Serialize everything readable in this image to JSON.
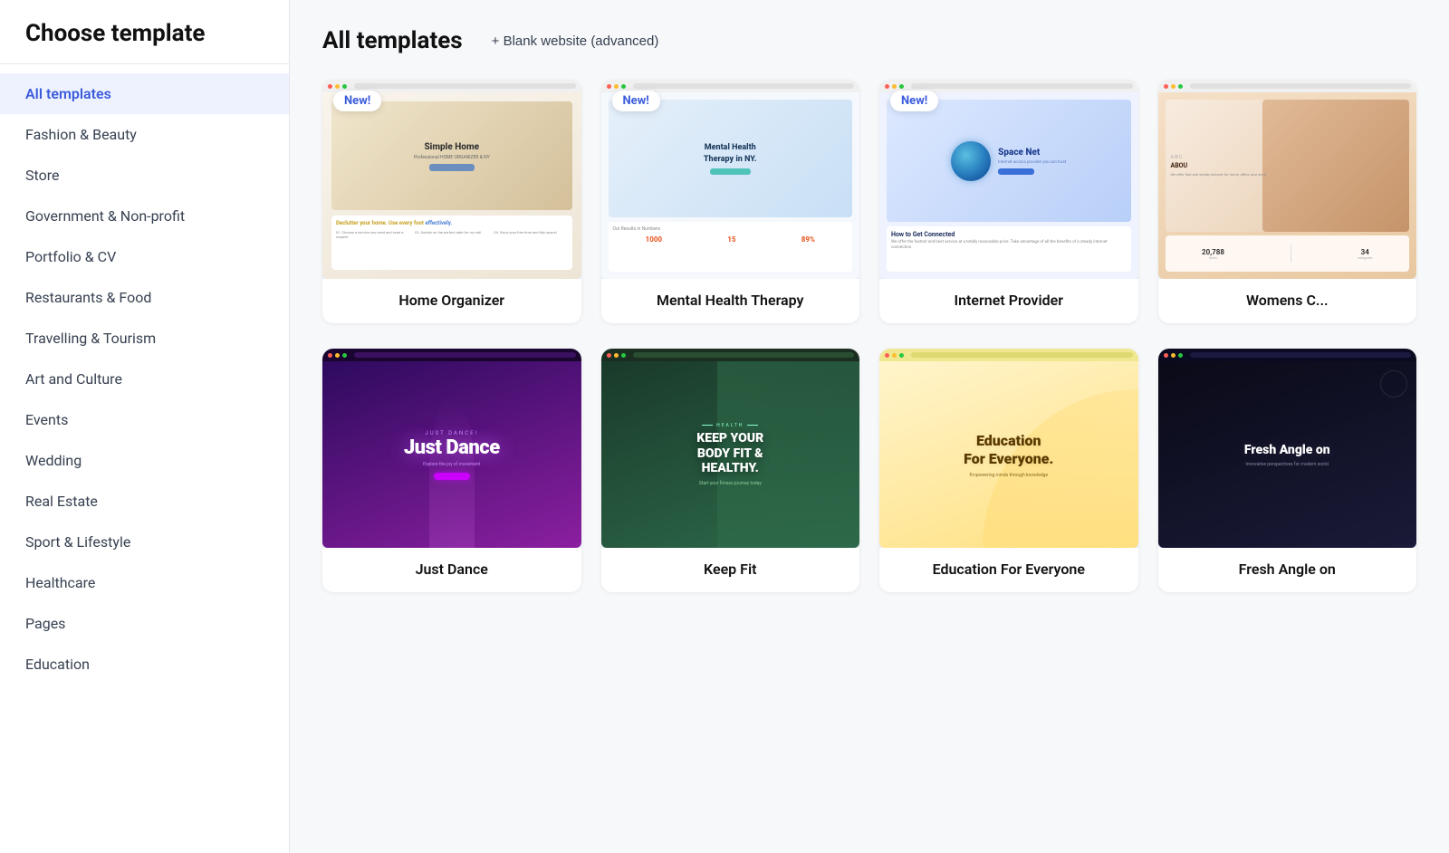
{
  "sidebar": {
    "title": "Choose template",
    "items": [
      {
        "id": "all-templates",
        "label": "All templates",
        "active": true
      },
      {
        "id": "fashion-beauty",
        "label": "Fashion & Beauty",
        "active": false
      },
      {
        "id": "store",
        "label": "Store",
        "active": false
      },
      {
        "id": "government-nonprofit",
        "label": "Government & Non-profit",
        "active": false
      },
      {
        "id": "portfolio-cv",
        "label": "Portfolio & CV",
        "active": false
      },
      {
        "id": "restaurants-food",
        "label": "Restaurants & Food",
        "active": false
      },
      {
        "id": "travelling-tourism",
        "label": "Travelling & Tourism",
        "active": false
      },
      {
        "id": "art-culture",
        "label": "Art and Culture",
        "active": false
      },
      {
        "id": "events",
        "label": "Events",
        "active": false
      },
      {
        "id": "wedding",
        "label": "Wedding",
        "active": false
      },
      {
        "id": "real-estate",
        "label": "Real Estate",
        "active": false
      },
      {
        "id": "sport-lifestyle",
        "label": "Sport & Lifestyle",
        "active": false
      },
      {
        "id": "healthcare",
        "label": "Healthcare",
        "active": false
      },
      {
        "id": "pages",
        "label": "Pages",
        "active": false
      },
      {
        "id": "education",
        "label": "Education",
        "active": false
      }
    ]
  },
  "header": {
    "title": "All templates",
    "blank_btn_label": "+ Blank website (advanced)"
  },
  "templates": {
    "row1": [
      {
        "id": "home-organizer",
        "label": "Home Organizer",
        "badge": "New!",
        "preview_type": "home-organizer"
      },
      {
        "id": "mental-health-therapy",
        "label": "Mental Health Therapy",
        "badge": "New!",
        "preview_type": "mental-health"
      },
      {
        "id": "internet-provider",
        "label": "Internet Provider",
        "badge": "New!",
        "preview_type": "internet-provider"
      },
      {
        "id": "womens-clothing",
        "label": "Womens C...",
        "badge": "",
        "preview_type": "womens"
      }
    ],
    "row2": [
      {
        "id": "just-dance",
        "label": "Just Dance",
        "badge": "",
        "preview_type": "just-dance"
      },
      {
        "id": "keep-fit",
        "label": "Keep Fit",
        "badge": "",
        "preview_type": "keep-fit"
      },
      {
        "id": "education-for-everyone",
        "label": "Education For Everyone",
        "badge": "",
        "preview_type": "education"
      },
      {
        "id": "fresh-angle",
        "label": "Fresh Angle on",
        "badge": "",
        "preview_type": "fresh-angle"
      }
    ]
  },
  "badge_text": "New!"
}
